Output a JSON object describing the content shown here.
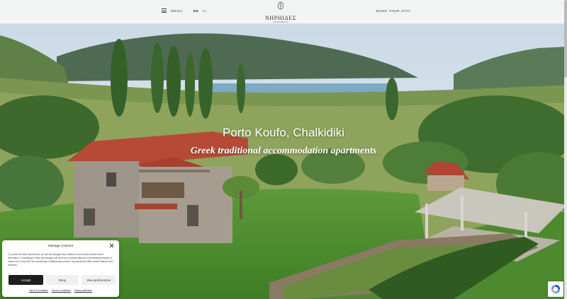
{
  "header": {
    "menu_label": "MENU",
    "lang_en": "EN",
    "lang_el": "EL",
    "logo_name": "ΝΗΡΗΙΔΕΣ",
    "logo_sub": "APARTMENTS",
    "book_label": "BOOK YOUR STAY"
  },
  "hero": {
    "title": "Porto Koufo, Chalkidiki",
    "subtitle": "Greek traditional accommodation apartments"
  },
  "consent": {
    "title": "Manage Consent",
    "text": "To provide the best experiences, we use technologies like cookies to store and/or access device information. Consenting to these technologies will allow us to process data such as browsing behavior or unique IDs on this site. Not consenting or withdrawing consent, may adversely affect certain features and functions.",
    "accept_label": "Accept",
    "deny_label": "Deny",
    "prefs_label": "View preferences",
    "link_terms": "Terms & conditions",
    "link_terms2": "Terms & conditions",
    "link_privacy": "Privacy statement"
  },
  "colors": {
    "header_bg": "#f5f5f3",
    "accept_bg": "#1e1e1e"
  }
}
